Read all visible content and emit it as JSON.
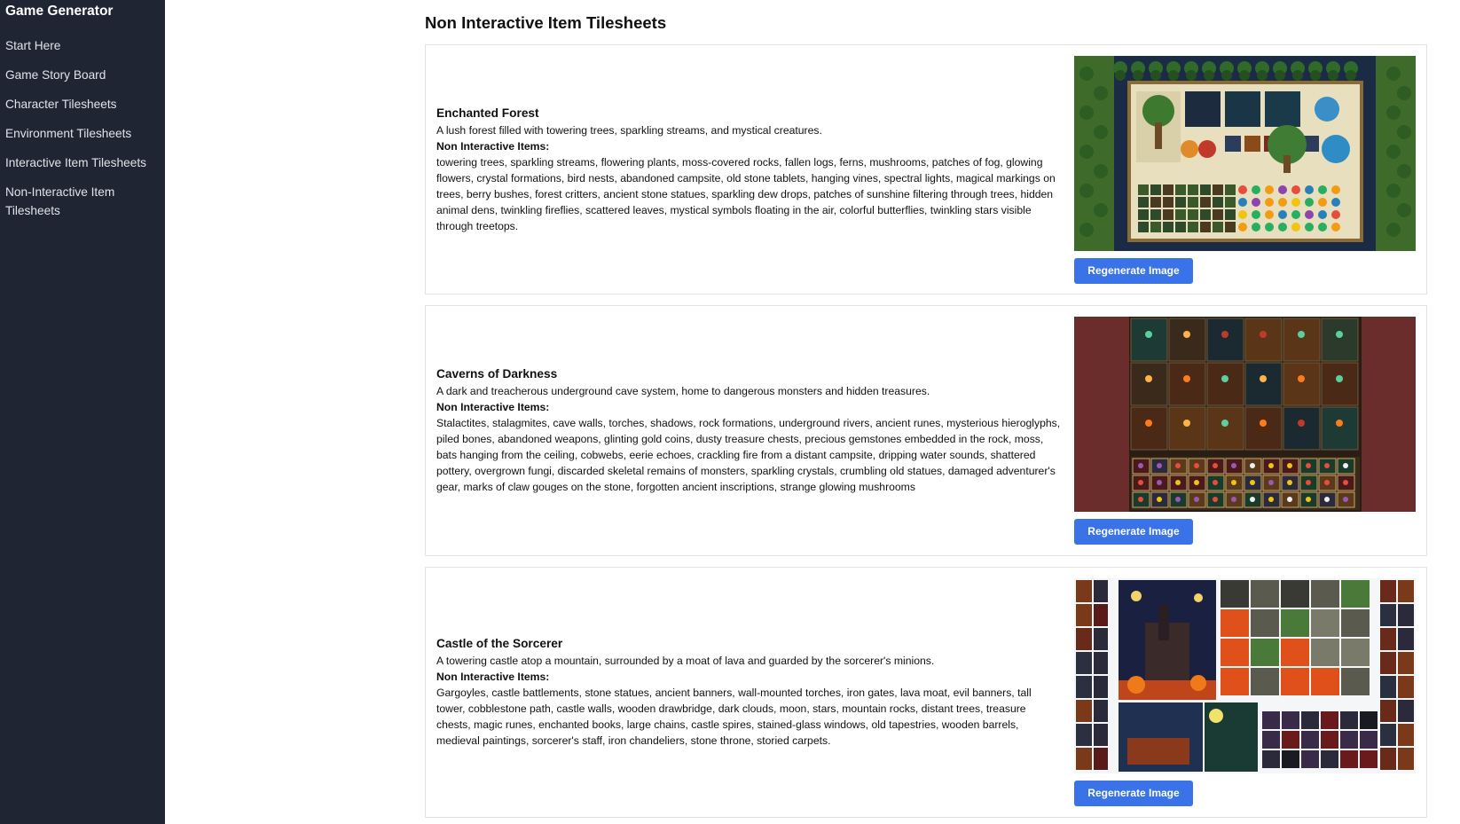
{
  "sidebar": {
    "brand": "Game Generator",
    "items": [
      {
        "label": "Start Here"
      },
      {
        "label": "Game Story Board"
      },
      {
        "label": "Character Tilesheets"
      },
      {
        "label": "Environment Tilesheets"
      },
      {
        "label": "Interactive Item Tilesheets"
      },
      {
        "label": "Non-Interactive Item Tilesheets"
      }
    ]
  },
  "main": {
    "title": "Non Interactive Item Tilesheets",
    "cards": [
      {
        "title": "Enchanted Forest",
        "description": "A lush forest filled with towering trees, sparkling streams, and mystical creatures.",
        "items_label": "Non Interactive Items:",
        "items": "towering trees, sparkling streams, flowering plants, moss-covered rocks, fallen logs, ferns, mushrooms, patches of fog, glowing flowers, crystal formations, bird nests, abandoned campsite, old stone tablets, hanging vines, spectral lights, magical markings on trees, berry bushes, forest critters, ancient stone statues, sparkling dew drops, patches of sunshine filtering through trees, hidden animal dens, twinkling fireflies, scattered leaves, mystical symbols floating in the air, colorful butterflies, twinkling stars visible through treetops.",
        "button_label": "Regenerate Image"
      },
      {
        "title": "Caverns of Darkness",
        "description": "A dark and treacherous underground cave system, home to dangerous monsters and hidden treasures.",
        "items_label": "Non Interactive Items:",
        "items": "Stalactites, stalagmites, cave walls, torches, shadows, rock formations, underground rivers, ancient runes, mysterious hieroglyphs, piled bones, abandoned weapons, glinting gold coins, dusty treasure chests, precious gemstones embedded in the rock, moss, bats hanging from the ceiling, cobwebs, eerie echoes, crackling fire from a distant campsite, dripping water sounds, shattered pottery, overgrown fungi, discarded skeletal remains of monsters, sparkling crystals, crumbling old statues, damaged adventurer's gear, marks of claw gouges on the stone, forgotten ancient inscriptions, strange glowing mushrooms",
        "button_label": "Regenerate Image"
      },
      {
        "title": "Castle of the Sorcerer",
        "description": "A towering castle atop a mountain, surrounded by a moat of lava and guarded by the sorcerer's minions.",
        "items_label": "Non Interactive Items:",
        "items": "Gargoyles, castle battlements, stone statues, ancient banners, wall-mounted torches, iron gates, lava moat, evil banners, tall tower, cobblestone path, castle walls, wooden drawbridge, dark clouds, moon, stars, mountain rocks, distant trees, treasure chests, magic runes, enchanted books, large chains, castle spires, stained-glass windows, old tapestries, wooden barrels, medieval paintings, sorcerer's staff, iron chandeliers, stone throne, storied carpets.",
        "button_label": "Regenerate Image"
      }
    ]
  }
}
